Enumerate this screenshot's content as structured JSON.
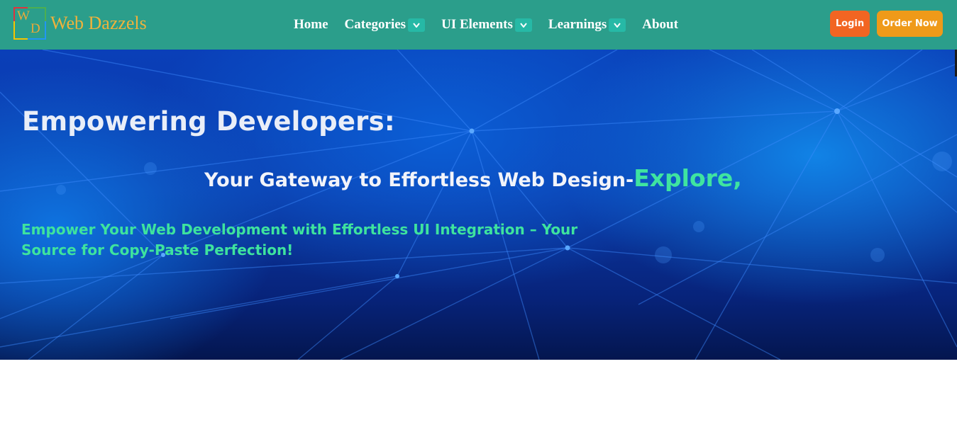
{
  "brand": {
    "logo_letter_1": "W",
    "logo_letter_2": "D",
    "name": "Web Dazzels"
  },
  "nav": {
    "items": [
      {
        "label": "Home",
        "has_dropdown": false
      },
      {
        "label": "Categories",
        "has_dropdown": true
      },
      {
        "label": "UI Elements",
        "has_dropdown": true
      },
      {
        "label": "Learnings",
        "has_dropdown": true
      },
      {
        "label": "About",
        "has_dropdown": false
      }
    ],
    "dropdown_icon": "chevron-down-icon"
  },
  "actions": {
    "login_label": "Login",
    "order_label": "Order Now"
  },
  "hero": {
    "heading": "Empowering Developers:",
    "subheading": "Your Gateway to Effortless Web Design-",
    "highlight": "Explore,",
    "tagline": "Empower Your Web Development with Effortless UI Integration – Your Source for Copy-Paste Perfection!"
  },
  "colors": {
    "navbar": "#2b9e8b",
    "brand_text": "#f0b23b",
    "login_button": "#f26522",
    "order_button": "#ef9a19",
    "accent_green": "#3fe4a0",
    "hero_blue": "#0a3fb8"
  }
}
